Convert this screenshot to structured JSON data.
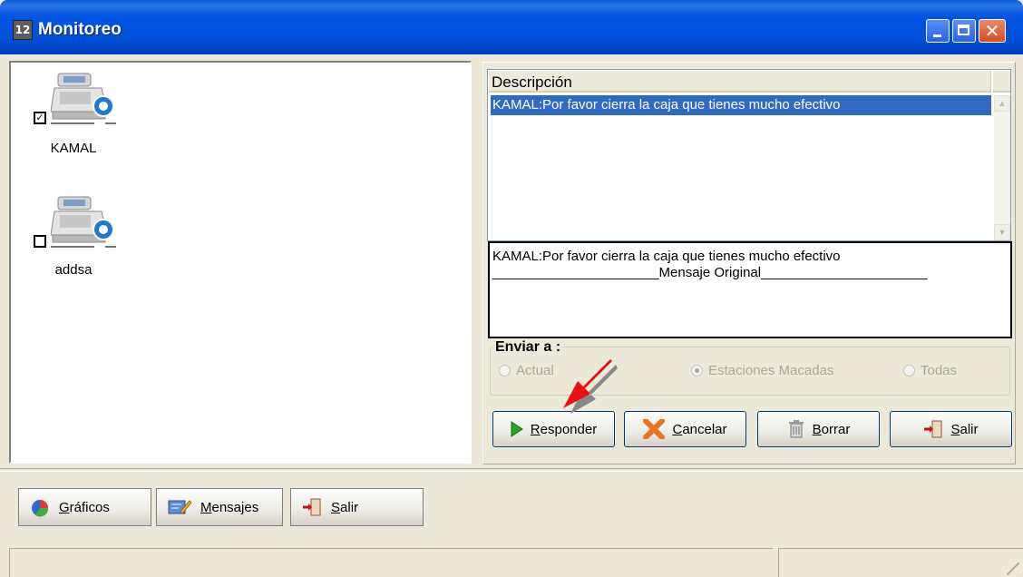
{
  "window": {
    "title": "Monitoreo",
    "title_icon": "app-icon"
  },
  "stations": [
    {
      "name": "KAMAL",
      "checked": true
    },
    {
      "name": "addsa",
      "checked": false
    }
  ],
  "messages_list": {
    "column_header": "Descripción",
    "rows": [
      "KAMAL:Por favor cierra la caja que tienes mucho efectivo"
    ]
  },
  "message_text": "KAMAL:Por favor cierra la caja que tienes mucho efectivo\n______________________Mensaje Original______________________",
  "send_to": {
    "legend": "Enviar a :",
    "options": [
      {
        "label": "Actual",
        "selected": false
      },
      {
        "label": "Estaciones Macadas",
        "selected": true
      },
      {
        "label": "Todas",
        "selected": false
      }
    ]
  },
  "action_buttons": {
    "responder": {
      "accel": "R",
      "rest": "esponder"
    },
    "cancelar": {
      "accel": "C",
      "rest": "ancelar"
    },
    "borrar": {
      "accel": "B",
      "rest": "orrar"
    },
    "salir": {
      "accel": "S",
      "rest": "alir"
    }
  },
  "bottom_buttons": {
    "graficos": {
      "accel": "G",
      "rest": "ráficos"
    },
    "mensajes": {
      "accel": "M",
      "rest": "ensajes"
    },
    "salir": {
      "accel": "S",
      "rest": "alir"
    }
  },
  "colors": {
    "titlebar": "#0054e3",
    "selection": "#316ac5",
    "annotation_arrow": "#e81010"
  }
}
